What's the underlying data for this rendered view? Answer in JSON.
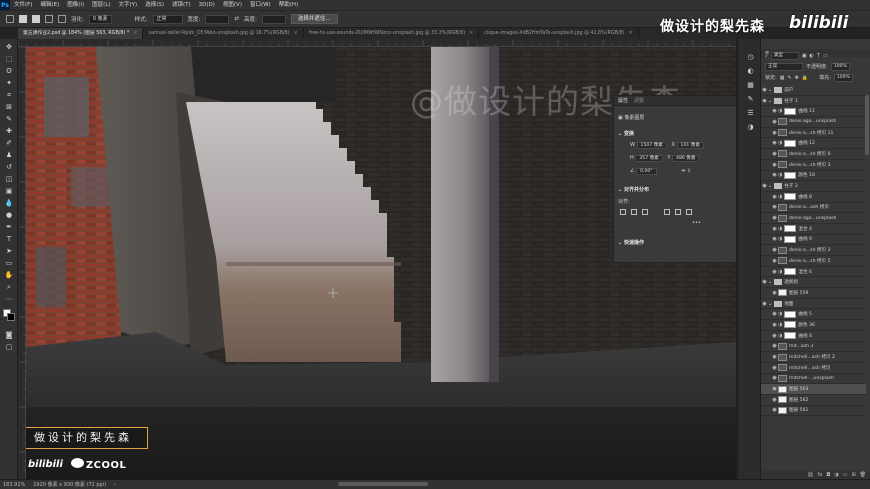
{
  "menu": {
    "logo": "Ps",
    "items": [
      "文件(F)",
      "编辑(E)",
      "图像(I)",
      "图层(L)",
      "文字(Y)",
      "选择(S)",
      "滤镜(T)",
      "3D(D)",
      "视图(V)",
      "窗口(W)",
      "帮助(H)"
    ]
  },
  "options": {
    "feather_label": "羽化:",
    "feather_value": "0 像素",
    "style_label": "样式:",
    "style_value": "正常",
    "width_label": "宽度:",
    "height_label": "高度:",
    "select_mask_button": "选择并遮住..."
  },
  "tabs": [
    {
      "label": "第五课作业2.psd @ 184% (图层 563, RGB/8) *",
      "active": true
    },
    {
      "label": "samuel-zeller-Rpim_O5YAbo-unsplash.jpg @ 16.7%(RGB/8)",
      "active": false
    },
    {
      "label": "free-to-use-sounds-ZUIM9HWNzco-unsplash.jpg @ 33.3%(RGB/8)",
      "active": false
    },
    {
      "label": "clique-images-XdB2HmTaTo-unsplash.jpg @ 42.8%(RGB/8)",
      "active": false
    }
  ],
  "canvas": {
    "watermark": "@做设计的梨先森"
  },
  "branding": {
    "channel_box": "做设计的梨先森",
    "bilibili": "bilibili",
    "zcool": "ZCOOL",
    "top_title": "做设计的梨先森",
    "top_bilibili": "bilibili"
  },
  "properties": {
    "tab_props": "属性",
    "tab_other": "调整",
    "doc_type": "像素图层",
    "transform_title": "变换",
    "w_label": "W",
    "w_value": "1507 像素",
    "x_label": "X",
    "x_value": "101 像素",
    "h_label": "H",
    "h_value": "357 像素",
    "y_label": "Y",
    "y_value": "486 像素",
    "angle_value": "0.00°",
    "align_title": "对齐并分布",
    "align_label": "对齐:",
    "quick_title": "快速操作"
  },
  "layers_panel": {
    "kind_label": "类型",
    "blend_mode": "正常",
    "opacity_label": "不透明度:",
    "opacity_value": "100%",
    "lock_label": "锁定:",
    "fill_label": "填充:",
    "fill_value": "100%",
    "layers": [
      {
        "name": "前户",
        "type": "group",
        "visible": true
      },
      {
        "name": "柱子 1",
        "type": "group",
        "visible": true
      },
      {
        "name": "曲线 11",
        "type": "adjust",
        "visible": true
      },
      {
        "name": "denis-aga...unsplash",
        "type": "image",
        "visible": true
      },
      {
        "name": "denis-a...sh 拷贝 11",
        "type": "image",
        "visible": true
      },
      {
        "name": "曲线 12",
        "type": "adjust",
        "visible": true
      },
      {
        "name": "denis-a...sh 拷贝 6",
        "type": "image",
        "visible": true
      },
      {
        "name": "denis-a...sh 拷贝 3",
        "type": "image",
        "visible": true
      },
      {
        "name": "颜色 18",
        "type": "adjust",
        "visible": true
      },
      {
        "name": "柱子 2",
        "type": "group",
        "visible": true
      },
      {
        "name": "曲线 8",
        "type": "adjust",
        "visible": true
      },
      {
        "name": "denis-a...ash 拷贝",
        "type": "image",
        "visible": true
      },
      {
        "name": "denis-aga...unsplash",
        "type": "image",
        "visible": true
      },
      {
        "name": "混合 4",
        "type": "adjust",
        "visible": true
      },
      {
        "name": "曲线 9",
        "type": "adjust",
        "visible": true
      },
      {
        "name": "denis-a...sh 拷贝 2",
        "type": "image",
        "visible": true
      },
      {
        "name": "denis-a...sh 拷贝 5",
        "type": "image",
        "visible": true
      },
      {
        "name": "混合 6",
        "type": "adjust",
        "visible": true
      },
      {
        "name": "透视组",
        "type": "group",
        "visible": true
      },
      {
        "name": "图层 559",
        "type": "layer",
        "visible": true
      },
      {
        "name": "地面",
        "type": "group",
        "visible": true
      },
      {
        "name": "曲线 5",
        "type": "adjust",
        "visible": true
      },
      {
        "name": "颜色 36",
        "type": "adjust",
        "visible": true
      },
      {
        "name": "曲线 4",
        "type": "adjust",
        "visible": true
      },
      {
        "name": "mit...ash 3",
        "type": "image",
        "visible": true
      },
      {
        "name": "mitchell...ash 拷贝 2",
        "type": "image",
        "visible": true
      },
      {
        "name": "mitchell...ash 拷贝",
        "type": "image",
        "visible": true
      },
      {
        "name": "mitchell-...unsplash",
        "type": "image",
        "visible": true
      },
      {
        "name": "图层 563",
        "type": "layer",
        "visible": true,
        "selected": true
      },
      {
        "name": "图层 562",
        "type": "layer",
        "visible": true
      },
      {
        "name": "图层 561",
        "type": "layer",
        "visible": true
      }
    ]
  },
  "status": {
    "zoom": "183.91%",
    "doc_size": "1920 像素 x 930 像素 (72 ppi)"
  }
}
